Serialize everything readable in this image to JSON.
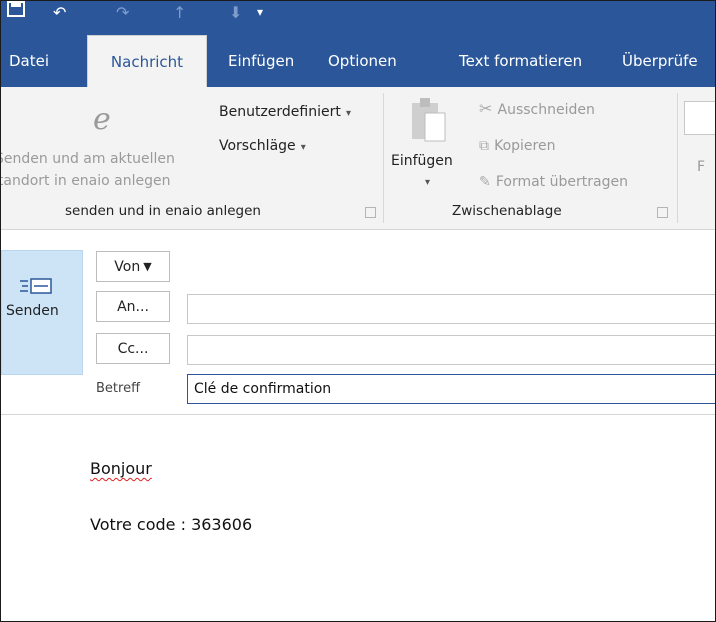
{
  "quick_access": {
    "save_icon": "save-icon",
    "undo_icon": "undo-icon",
    "redo_icon": "redo-icon",
    "up_icon": "up-arrow-icon",
    "down_icon": "down-arrow-icon",
    "customize_icon": "customize-icon"
  },
  "ribbon_tabs": [
    "Datei",
    "Nachricht",
    "Einfügen",
    "Optionen",
    "Text formatieren",
    "Überprüfe"
  ],
  "active_tab": "Nachricht",
  "ribbon": {
    "enaio": {
      "send_label_line1": "Senden und am aktuellen",
      "send_label_line2": "Standort in enaio anlegen",
      "custom_label": "Benutzerdefiniert",
      "suggestions_label": "Vorschläge",
      "group_label": "senden und in enaio anlegen"
    },
    "clipboard": {
      "paste_label": "Einfügen",
      "cut_label": "Ausschneiden",
      "copy_label": "Kopieren",
      "format_label": "Format übertragen",
      "group_label": "Zwischenablage"
    },
    "font_letter": "F"
  },
  "compose": {
    "send_label": "Senden",
    "from_label": "Von",
    "to_label": "An...",
    "cc_label": "Cc...",
    "subject_label": "Betreff",
    "subject_value": "Clé de confirmation",
    "to_value": "",
    "cc_value": ""
  },
  "message_body": {
    "line1": "Bonjour",
    "line2": "Votre code : 363606"
  },
  "colors": {
    "accent": "#2b579a",
    "send_highlight": "#cde4f7",
    "ribbon_bg": "#f3f3f3"
  }
}
